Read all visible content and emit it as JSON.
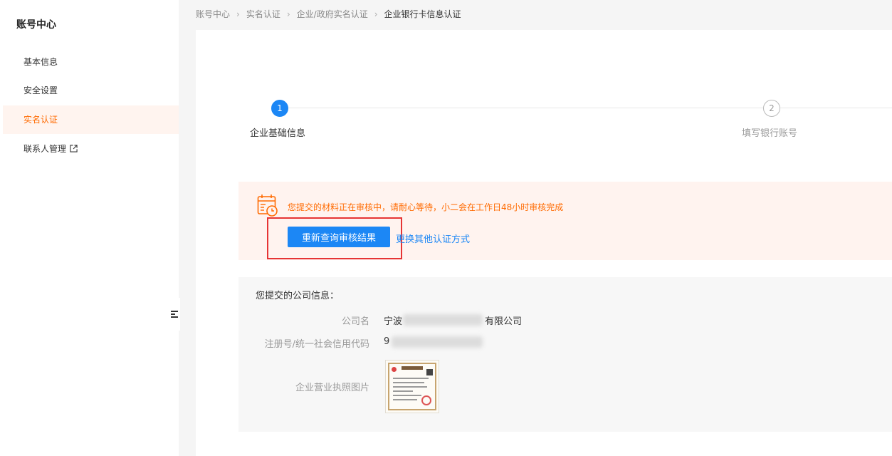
{
  "sidebar": {
    "title": "账号中心",
    "items": [
      {
        "label": "基本信息"
      },
      {
        "label": "安全设置"
      },
      {
        "label": "实名认证",
        "active": true
      },
      {
        "label": "联系人管理",
        "external": true
      }
    ]
  },
  "breadcrumb": [
    "账号中心",
    "实名认证",
    "企业/政府实名认证",
    "企业银行卡信息认证"
  ],
  "steps": [
    {
      "num": "1",
      "label": "企业基础信息",
      "state": "active"
    },
    {
      "num": "2",
      "label": "填写银行账号",
      "state": "pending"
    }
  ],
  "notice": {
    "text": "您提交的材料正在审核中，请耐心等待，小二会在工作日48小时审核完成",
    "requery_button": "重新查询审核结果",
    "switch_link": "更换其他认证方式"
  },
  "company_info": {
    "title": "您提交的公司信息：",
    "name_label": "公司名",
    "name_prefix": "宁波",
    "name_suffix": "有限公司",
    "code_label": "注册号/统一社会信用代码",
    "code_prefix": "9",
    "license_label": "企业营业执照图片"
  },
  "colors": {
    "accent": "#ff6a00",
    "primary": "#1c87f5",
    "highlight": "#e63434"
  }
}
